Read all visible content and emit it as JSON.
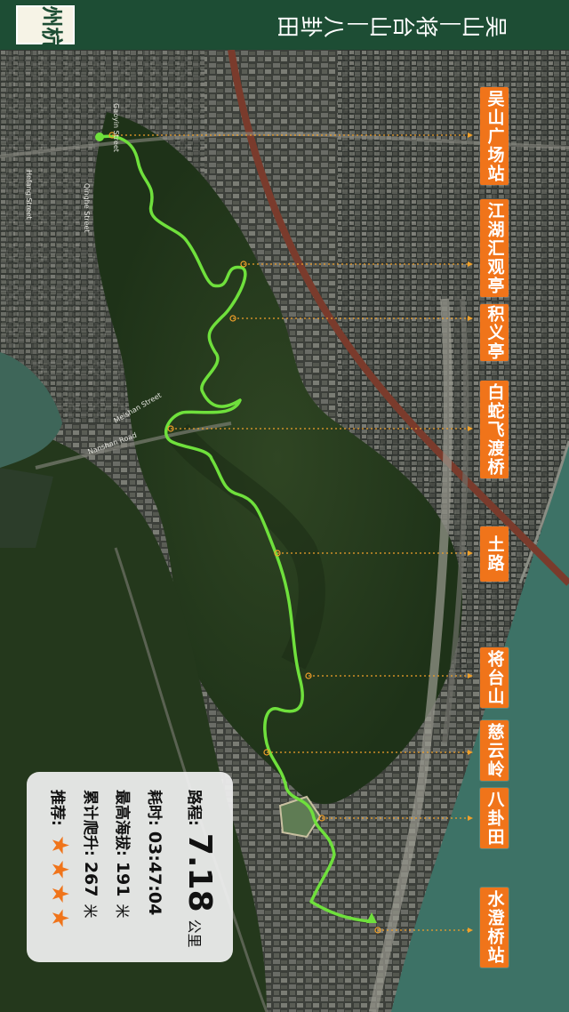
{
  "city": "杭州",
  "route_title": "吴山—将台山—八卦田",
  "stations": [
    {
      "id": "wushan",
      "name": "吴山广场站"
    },
    {
      "id": "jianghu",
      "name": "江湖汇观亭"
    },
    {
      "id": "jiyi",
      "name": "积义亭"
    },
    {
      "id": "baishe",
      "name": "白蛇飞渡桥"
    },
    {
      "id": "tulu",
      "name": "土路"
    },
    {
      "id": "jiangtai",
      "name": "将台山"
    },
    {
      "id": "ciyun",
      "name": "慈云岭"
    },
    {
      "id": "bagua",
      "name": "八卦田"
    },
    {
      "id": "shuicheng",
      "name": "水澄桥站"
    }
  ],
  "stats": {
    "distance_label": "路程:",
    "distance_value": "7.18",
    "distance_unit": "公里",
    "time_label": "耗时:",
    "time_value": "03:47:04",
    "altitude_label": "最高海拔:",
    "altitude_value": "191",
    "altitude_unit": "米",
    "climb_label": "累计爬升:",
    "climb_value": "267",
    "climb_unit": "米",
    "rating_label": "推荐:",
    "rating": 4
  },
  "map_labels": [
    "Gaoyin Street",
    "Hefang Street",
    "Qinghe Street",
    "Nanshan Road",
    "Meishan Street"
  ],
  "colors": {
    "header_bg": "#1d4d34",
    "tag_bg": "#f0741a",
    "track": "#6fe03c",
    "star": "#f0741a"
  }
}
